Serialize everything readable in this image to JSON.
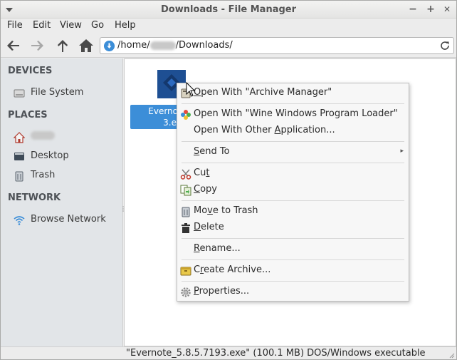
{
  "window": {
    "title": "Downloads - File Manager",
    "controls": {
      "minimize": "−",
      "maximize": "+",
      "close": "✕"
    }
  },
  "menubar": {
    "items": [
      "File",
      "Edit",
      "View",
      "Go",
      "Help"
    ]
  },
  "toolbar": {
    "location": {
      "prefix": "/home/",
      "suffix": "/Downloads/"
    }
  },
  "sidebar": {
    "devices_heading": "DEVICES",
    "places_heading": "PLACES",
    "network_heading": "NETWORK",
    "devices": [
      {
        "label": "File System",
        "icon": "drive-icon"
      }
    ],
    "places": [
      {
        "label": "",
        "icon": "home-icon"
      },
      {
        "label": "Desktop",
        "icon": "desktop-icon"
      },
      {
        "label": "Trash",
        "icon": "trash-icon"
      }
    ],
    "network": [
      {
        "label": "Browse Network",
        "icon": "network-icon"
      }
    ]
  },
  "main": {
    "file": {
      "line1": "Evernote_5",
      "line2": "3.ex"
    }
  },
  "context_menu": {
    "items": [
      {
        "pre": "",
        "ul": "O",
        "post": "pen With \"Archive Manager\"",
        "icon": "archive-manager-icon"
      },
      {
        "pre": "Open With \"Wine Windows Program Loader\"",
        "ul": "",
        "post": "",
        "icon": "wine-icon"
      },
      {
        "pre": "Open With Other ",
        "ul": "A",
        "post": "pplication...",
        "icon": ""
      },
      {
        "pre": "",
        "ul": "S",
        "post": "end To",
        "icon": ""
      },
      {
        "pre": "Cu",
        "ul": "t",
        "post": "",
        "icon": "scissors-icon"
      },
      {
        "pre": "",
        "ul": "C",
        "post": "opy",
        "icon": "copy-icon"
      },
      {
        "pre": "Mo",
        "ul": "v",
        "post": "e to Trash",
        "icon": "trash-icon"
      },
      {
        "pre": "",
        "ul": "D",
        "post": "elete",
        "icon": "delete-icon"
      },
      {
        "pre": "",
        "ul": "R",
        "post": "ename...",
        "icon": ""
      },
      {
        "pre": "C",
        "ul": "r",
        "post": "eate Archive...",
        "icon": "create-archive-icon"
      },
      {
        "pre": "",
        "ul": "P",
        "post": "roperties...",
        "icon": "properties-icon"
      }
    ]
  },
  "statusbar": {
    "text": "\"Evernote_5.8.5.7193.exe\" (100.1 MB) DOS/Windows executable"
  },
  "colors": {
    "selection": "#3c8ed8",
    "sidebar_bg": "#e2e5e8",
    "window_bg": "#ececec"
  }
}
